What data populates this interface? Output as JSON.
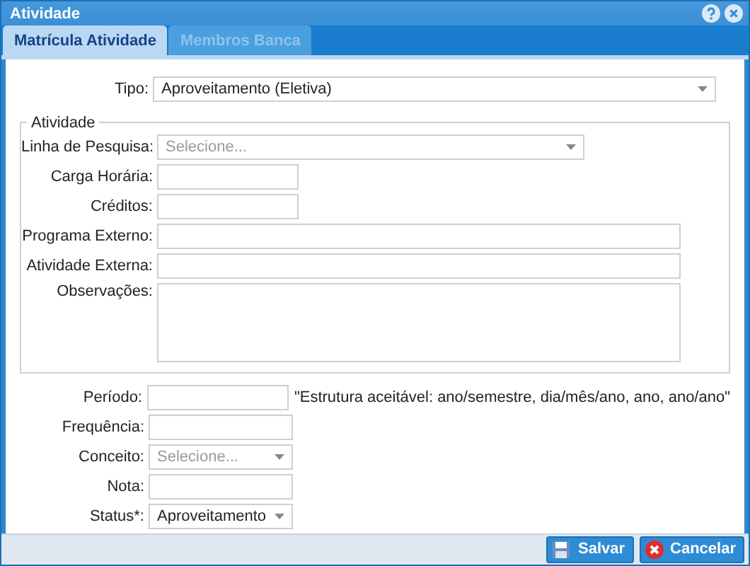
{
  "window": {
    "title": "Atividade"
  },
  "tabs": [
    {
      "label": "Matrícula Atividade",
      "selected": true
    },
    {
      "label": "Membros Banca",
      "selected": false
    }
  ],
  "tipo": {
    "kind": "select",
    "label": "Tipo:",
    "value": "Aproveitamento (Eletiva)"
  },
  "fieldset": {
    "legend": "Atividade",
    "fields": [
      {
        "kind": "select",
        "label": "Linha de Pesquisa:",
        "placeholder": "Selecione..."
      },
      {
        "kind": "text",
        "label": "Carga Horária:"
      },
      {
        "kind": "text",
        "label": "Créditos:"
      },
      {
        "kind": "text",
        "label": "Programa Externo:"
      },
      {
        "kind": "text",
        "label": "Atividade Externa:"
      },
      {
        "kind": "textarea",
        "label": "Observações:"
      }
    ]
  },
  "fields": [
    {
      "kind": "text",
      "label": "Período:",
      "note": "\"Estrutura aceitável: ano/semestre, dia/mês/ano, ano, ano/ano\""
    },
    {
      "kind": "text",
      "label": "Frequência:"
    },
    {
      "kind": "select",
      "label": "Conceito:",
      "placeholder": "Selecione..."
    },
    {
      "kind": "text",
      "label": "Nota:"
    },
    {
      "kind": "select",
      "label": "Status*:",
      "value": "Aproveitamento"
    }
  ],
  "buttons": [
    {
      "kind": "save",
      "label": "Salvar"
    },
    {
      "kind": "cancel",
      "label": "Cancelar"
    }
  ]
}
